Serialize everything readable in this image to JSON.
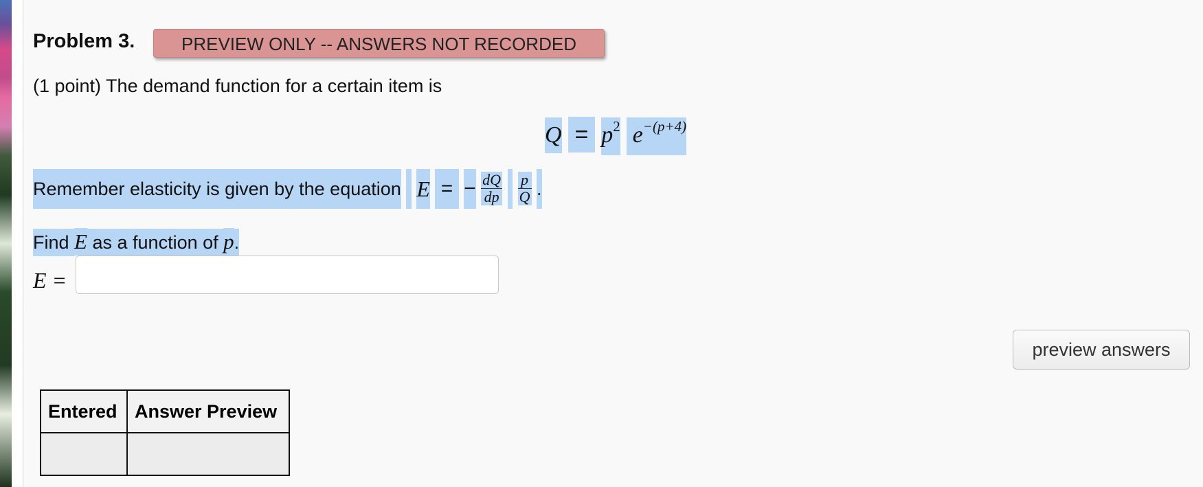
{
  "problem": {
    "title": "Problem 3.",
    "badge": "PREVIEW ONLY -- ANSWERS NOT RECORDED",
    "intro": "(1 point) The demand function for a certain item is",
    "equation": {
      "lhs": "Q",
      "equals": "=",
      "base": "p",
      "base_exp": "2",
      "exp_base": "e",
      "exponent": "−(p+4)"
    },
    "remember": {
      "text": "Remember elasticity is given by the equation",
      "var": "E",
      "equals": "=",
      "minus": "−",
      "frac1_num": "dQ",
      "frac1_den": "dp",
      "frac2_num": "p",
      "frac2_den": "Q",
      "period": "."
    },
    "find": {
      "prefix": "Find",
      "var": "E",
      "middle": "as a function of",
      "of_var": "p",
      "period": "."
    },
    "answer": {
      "label": "E =",
      "value": "",
      "placeholder": ""
    },
    "preview_button": "preview answers",
    "results_table": {
      "headers": [
        "Entered",
        "Answer Preview"
      ],
      "rows": [
        [
          "",
          ""
        ]
      ]
    }
  },
  "colors": {
    "badge_bg": "#d99493",
    "highlight": "#b7d6f6",
    "panel_bg": "#f9f9f9"
  }
}
